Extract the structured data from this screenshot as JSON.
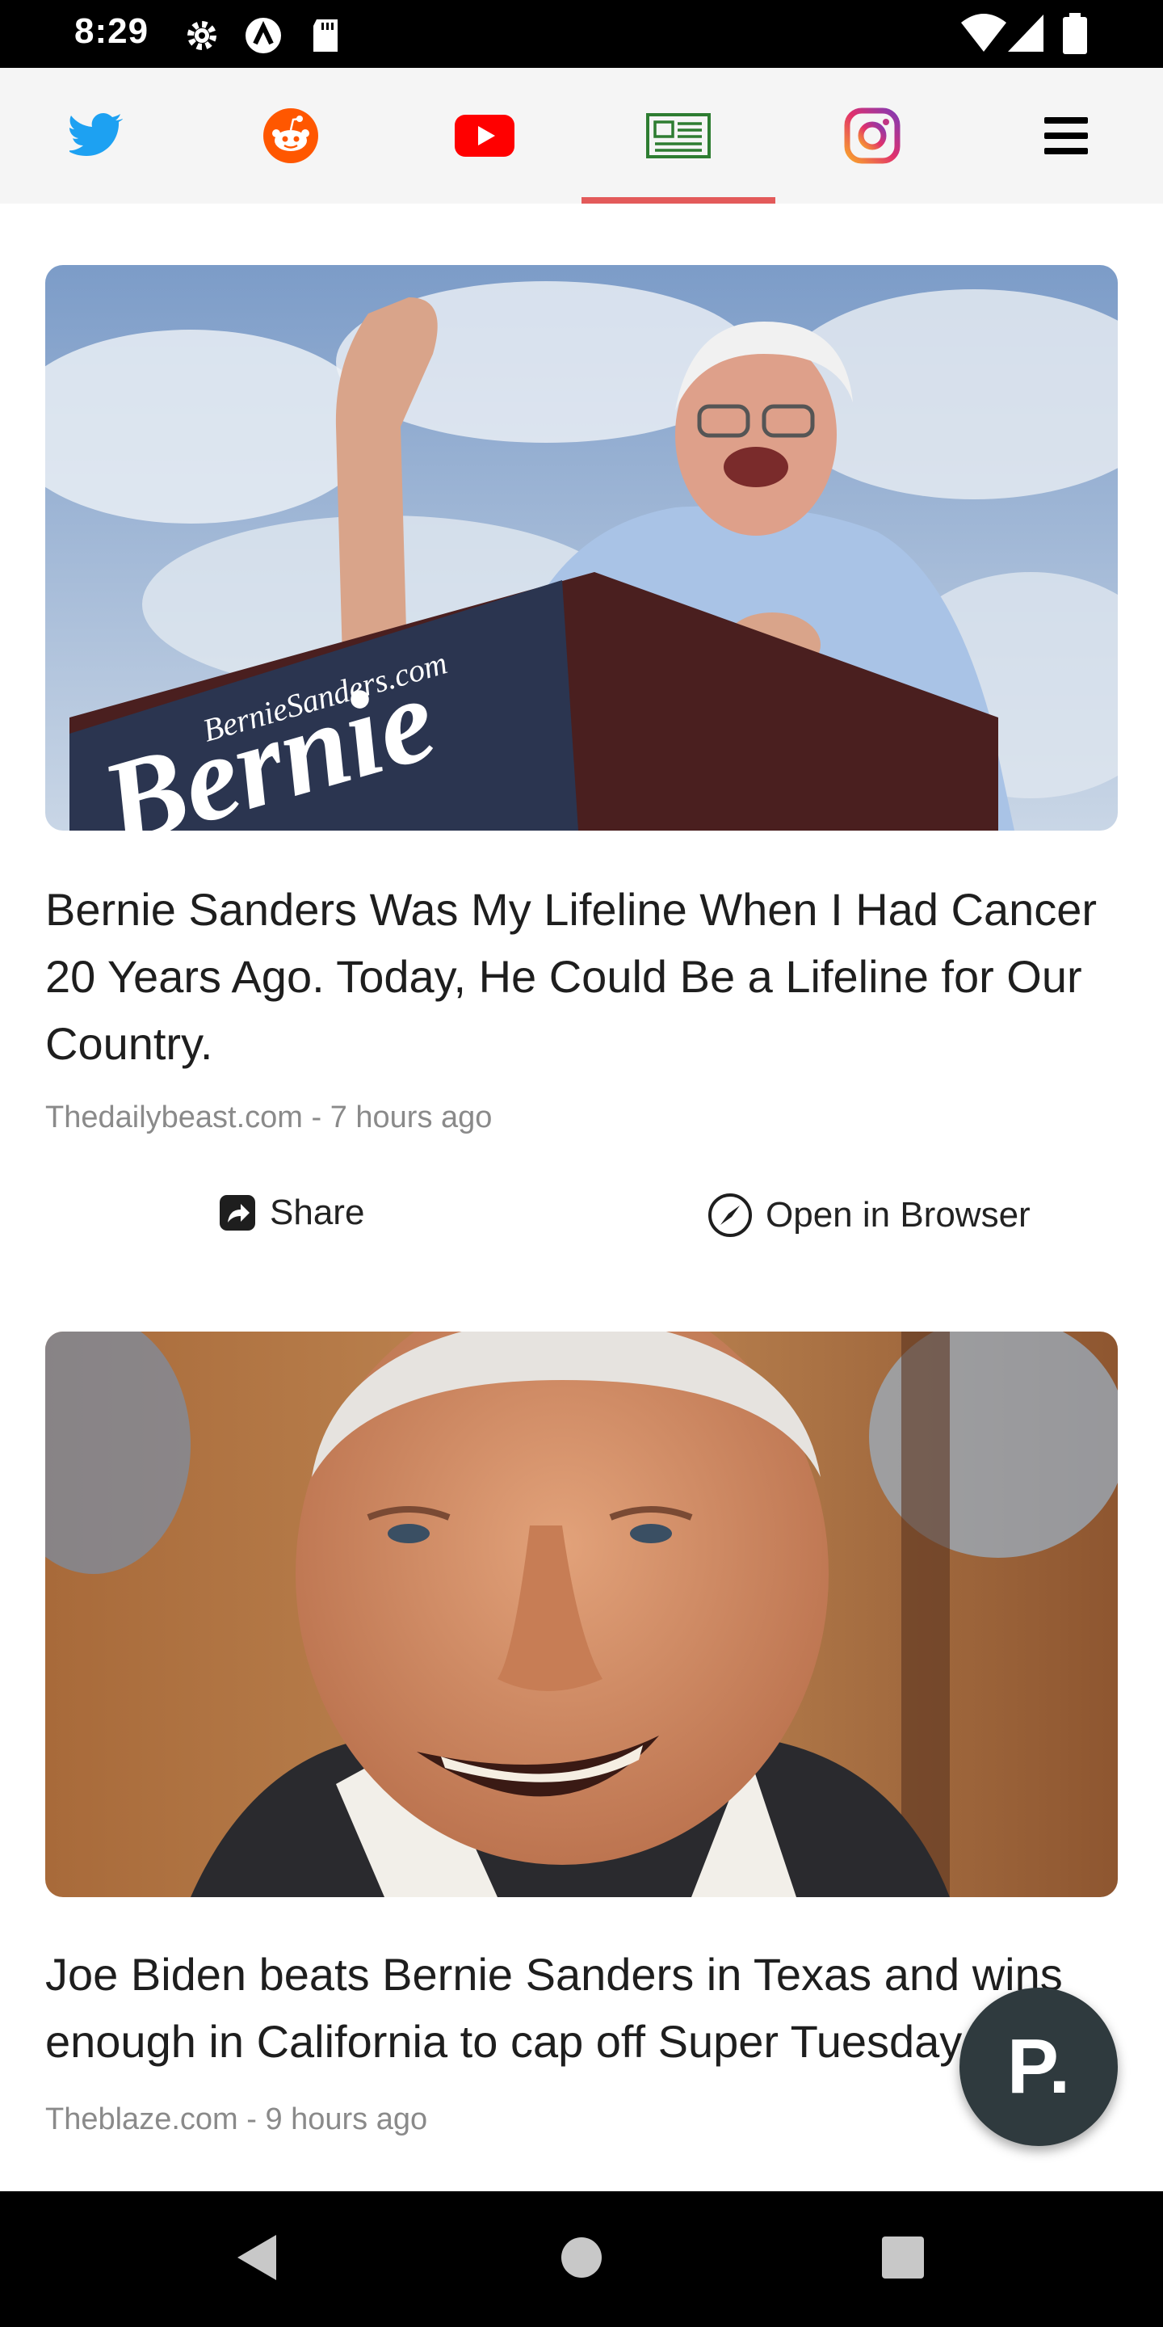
{
  "status_bar": {
    "time": "8:29",
    "icons": [
      "gear-icon",
      "a-circle-icon",
      "sd-card-icon",
      "wifi-icon",
      "signal-icon",
      "battery-icon"
    ]
  },
  "tabs": [
    {
      "name": "twitter",
      "icon": "twitter-icon",
      "color": "#1da1f2"
    },
    {
      "name": "reddit",
      "icon": "reddit-icon",
      "color": "#ff5700"
    },
    {
      "name": "youtube",
      "icon": "youtube-icon",
      "color": "#ff0000"
    },
    {
      "name": "news",
      "icon": "newspaper-icon",
      "color": "#2e7d32",
      "active": true
    },
    {
      "name": "instagram",
      "icon": "instagram-icon",
      "color": "#c13584"
    },
    {
      "name": "menu",
      "icon": "hamburger-menu-icon",
      "color": "#000000"
    }
  ],
  "accent_color": "#e35a5a",
  "articles": [
    {
      "image": "photo-bernie-sanders-at-podium",
      "image_text": {
        "site": "BernieSanders.com",
        "name": "Bernie"
      },
      "title": "Bernie Sanders Was My Lifeline When I Had Cancer 20 Years Ago. Today, He Could Be a Lifeline for Our Country.",
      "source": "Thedailybeast.com - 7 hours ago",
      "share_label": "Share",
      "open_label": "Open in Browser"
    },
    {
      "image": "photo-joe-biden-smiling",
      "title": "Joe Biden beats Bernie Sanders in Texas and wins enough in California to cap off Super Tuesday out",
      "source": "Theblaze.com - 9 hours ago"
    }
  ],
  "fab": {
    "label": "P."
  },
  "nav": [
    "back-icon",
    "home-icon",
    "recents-icon"
  ]
}
